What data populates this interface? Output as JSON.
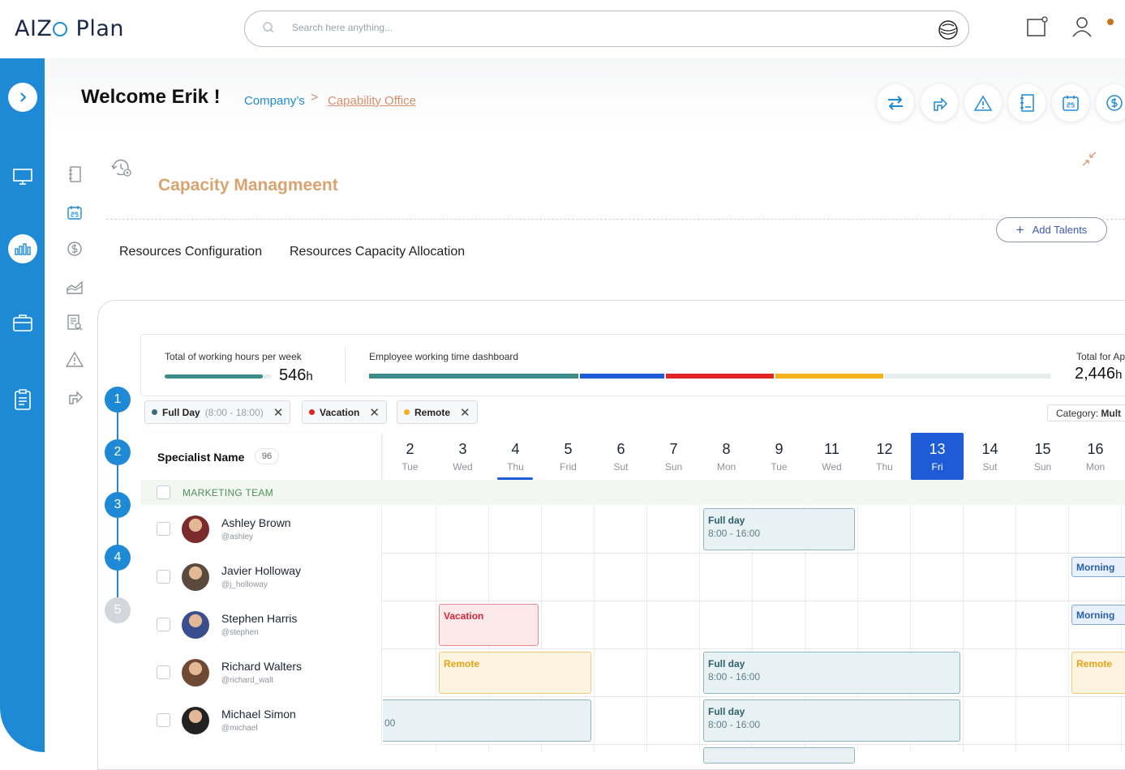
{
  "app": {
    "logo_left": "AIZ",
    "logo_right": "Plan"
  },
  "search": {
    "placeholder": "Search here anything..."
  },
  "header": {
    "welcome": "Welcome Erik !",
    "breadcrumb": [
      "Company’s",
      "Capability Office"
    ],
    "breadcrumb_sep": ">"
  },
  "page": {
    "title": "Capacity Managmeent",
    "add_talents": "Add Talents",
    "tabs": [
      "Resources Configuration",
      "Resources Capacity Allocation"
    ]
  },
  "stats": {
    "weekly_label": "Total of working hours per week",
    "weekly_value": "546",
    "weekly_unit": "h",
    "weekly_progress": 0.92,
    "dashboard_label": "Employee working time dashboard",
    "dashboard_segments": [
      {
        "fraction": 0.31,
        "color": "#3b8b86"
      },
      {
        "fraction": 0.125,
        "color": "#1e5bd6"
      },
      {
        "fraction": 0.16,
        "color": "#e02424"
      },
      {
        "fraction": 0.16,
        "color": "#f5b11c"
      },
      {
        "fraction": 0.245,
        "color": "#e4efec"
      }
    ],
    "total_label": "Total for Ap",
    "total_value": "2,446",
    "total_unit": "h"
  },
  "steps": [
    "1",
    "2",
    "3",
    "4",
    "5"
  ],
  "filters": [
    {
      "label": "Full Day",
      "detail": "(8:00 - 18:00)",
      "color": "#3b6b7a"
    },
    {
      "label": "Vacation",
      "detail": "",
      "color": "#e02424"
    },
    {
      "label": "Remote",
      "detail": "",
      "color": "#f5b11c"
    }
  ],
  "filter_close": "✕",
  "category": {
    "label": "Category:",
    "value": "Mult"
  },
  "table": {
    "name_header": "Specialist Name",
    "count": "96",
    "team": "MARKETING TEAM",
    "days": [
      {
        "n": "2",
        "d": "Tue"
      },
      {
        "n": "3",
        "d": "Wed"
      },
      {
        "n": "4",
        "d": "Thu",
        "selected": true
      },
      {
        "n": "5",
        "d": "Frid"
      },
      {
        "n": "6",
        "d": "Sut"
      },
      {
        "n": "7",
        "d": "Sun"
      },
      {
        "n": "8",
        "d": "Mon"
      },
      {
        "n": "9",
        "d": "Tue"
      },
      {
        "n": "11",
        "d": "Wed"
      },
      {
        "n": "12",
        "d": "Thu"
      },
      {
        "n": "13",
        "d": "Fri",
        "today": true
      },
      {
        "n": "14",
        "d": "Sut"
      },
      {
        "n": "15",
        "d": "Sun"
      },
      {
        "n": "16",
        "d": "Mon"
      }
    ],
    "people": [
      {
        "name": "Ashley Brown",
        "user": "@ashley",
        "avatar_color": "#7b2b2b"
      },
      {
        "name": "Javier Holloway",
        "user": "@j_holloway",
        "avatar_color": "#5a4a3e"
      },
      {
        "name": "Stephen Harris",
        "user": "@stephen",
        "avatar_color": "#3a4d8c"
      },
      {
        "name": "Richard Walters",
        "user": "@richard_walt",
        "avatar_color": "#6e4a34"
      },
      {
        "name": "Michael Simon",
        "user": "@michael",
        "avatar_color": "#222222"
      }
    ],
    "events": {
      "full_day": "Full day",
      "full_time": "8:00 - 16:00",
      "vacation": "Vacation",
      "remote": "Remote",
      "morning": "Morning",
      "partial": "00"
    }
  }
}
